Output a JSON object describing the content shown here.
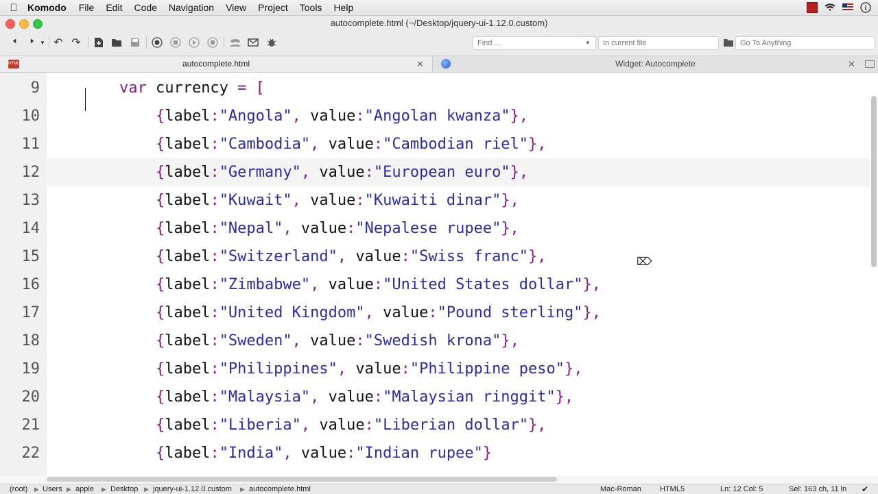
{
  "menubar": {
    "app": "Komodo",
    "items": [
      "File",
      "Edit",
      "Code",
      "Navigation",
      "View",
      "Project",
      "Tools",
      "Help"
    ]
  },
  "window": {
    "title": "autocomplete.html (~/Desktop/jquery-ui-1.12.0.custom)"
  },
  "toolbar": {
    "find_placeholder": "Find ...",
    "scope_placeholder": "In current file",
    "goto_placeholder": "Go To Anything"
  },
  "tabs": [
    {
      "label": "autocomplete.html",
      "icon": "html-file-icon",
      "active": true
    },
    {
      "label": "Widget: Autocomplete",
      "icon": "globe-icon",
      "active": false
    }
  ],
  "editor": {
    "current_line": 12,
    "lines": [
      {
        "number": "9",
        "tokens": [
          [
            "plain",
            "        "
          ],
          [
            "kw",
            "var"
          ],
          [
            "plain",
            " currency "
          ],
          [
            "op",
            "="
          ],
          [
            "plain",
            " "
          ],
          [
            "op",
            "["
          ]
        ]
      },
      {
        "number": "10",
        "tokens": [
          [
            "plain",
            "            "
          ],
          [
            "op",
            "{"
          ],
          [
            "plain",
            "label"
          ],
          [
            "op",
            ":"
          ],
          [
            "str",
            "\"Angola\""
          ],
          [
            "op",
            ","
          ],
          [
            "plain",
            " value"
          ],
          [
            "op",
            ":"
          ],
          [
            "str",
            "\"Angolan kwanza\""
          ],
          [
            "op",
            "},"
          ]
        ]
      },
      {
        "number": "11",
        "tokens": [
          [
            "plain",
            "            "
          ],
          [
            "op",
            "{"
          ],
          [
            "plain",
            "label"
          ],
          [
            "op",
            ":"
          ],
          [
            "str",
            "\"Cambodia\""
          ],
          [
            "op",
            ","
          ],
          [
            "plain",
            " value"
          ],
          [
            "op",
            ":"
          ],
          [
            "str",
            "\"Cambodian riel\""
          ],
          [
            "op",
            "},"
          ]
        ]
      },
      {
        "number": "12",
        "tokens": [
          [
            "plain",
            "            "
          ],
          [
            "op",
            "{"
          ],
          [
            "plain",
            "label"
          ],
          [
            "op",
            ":"
          ],
          [
            "str",
            "\"Germany\""
          ],
          [
            "op",
            ","
          ],
          [
            "plain",
            " value"
          ],
          [
            "op",
            ":"
          ],
          [
            "str",
            "\"European euro\""
          ],
          [
            "op",
            "},"
          ]
        ]
      },
      {
        "number": "13",
        "tokens": [
          [
            "plain",
            "            "
          ],
          [
            "op",
            "{"
          ],
          [
            "plain",
            "label"
          ],
          [
            "op",
            ":"
          ],
          [
            "str",
            "\"Kuwait\""
          ],
          [
            "op",
            ","
          ],
          [
            "plain",
            " value"
          ],
          [
            "op",
            ":"
          ],
          [
            "str",
            "\"Kuwaiti dinar\""
          ],
          [
            "op",
            "},"
          ]
        ]
      },
      {
        "number": "14",
        "tokens": [
          [
            "plain",
            "            "
          ],
          [
            "op",
            "{"
          ],
          [
            "plain",
            "label"
          ],
          [
            "op",
            ":"
          ],
          [
            "str",
            "\"Nepal\""
          ],
          [
            "op",
            ","
          ],
          [
            "plain",
            " value"
          ],
          [
            "op",
            ":"
          ],
          [
            "str",
            "\"Nepalese rupee\""
          ],
          [
            "op",
            "},"
          ]
        ]
      },
      {
        "number": "15",
        "tokens": [
          [
            "plain",
            "            "
          ],
          [
            "op",
            "{"
          ],
          [
            "plain",
            "label"
          ],
          [
            "op",
            ":"
          ],
          [
            "str",
            "\"Switzerland\""
          ],
          [
            "op",
            ","
          ],
          [
            "plain",
            " value"
          ],
          [
            "op",
            ":"
          ],
          [
            "str",
            "\"Swiss franc\""
          ],
          [
            "op",
            "},"
          ]
        ]
      },
      {
        "number": "16",
        "tokens": [
          [
            "plain",
            "            "
          ],
          [
            "op",
            "{"
          ],
          [
            "plain",
            "label"
          ],
          [
            "op",
            ":"
          ],
          [
            "str",
            "\"Zimbabwe\""
          ],
          [
            "op",
            ","
          ],
          [
            "plain",
            " value"
          ],
          [
            "op",
            ":"
          ],
          [
            "str",
            "\"United States dollar\""
          ],
          [
            "op",
            "},"
          ]
        ]
      },
      {
        "number": "17",
        "tokens": [
          [
            "plain",
            "            "
          ],
          [
            "op",
            "{"
          ],
          [
            "plain",
            "label"
          ],
          [
            "op",
            ":"
          ],
          [
            "str",
            "\"United Kingdom\""
          ],
          [
            "op",
            ","
          ],
          [
            "plain",
            " value"
          ],
          [
            "op",
            ":"
          ],
          [
            "str",
            "\"Pound sterling\""
          ],
          [
            "op",
            "},"
          ]
        ]
      },
      {
        "number": "18",
        "tokens": [
          [
            "plain",
            "            "
          ],
          [
            "op",
            "{"
          ],
          [
            "plain",
            "label"
          ],
          [
            "op",
            ":"
          ],
          [
            "str",
            "\"Sweden\""
          ],
          [
            "op",
            ","
          ],
          [
            "plain",
            " value"
          ],
          [
            "op",
            ":"
          ],
          [
            "str",
            "\"Swedish krona\""
          ],
          [
            "op",
            "},"
          ]
        ]
      },
      {
        "number": "19",
        "tokens": [
          [
            "plain",
            "            "
          ],
          [
            "op",
            "{"
          ],
          [
            "plain",
            "label"
          ],
          [
            "op",
            ":"
          ],
          [
            "str",
            "\"Philippines\""
          ],
          [
            "op",
            ","
          ],
          [
            "plain",
            " value"
          ],
          [
            "op",
            ":"
          ],
          [
            "str",
            "\"Philippine peso\""
          ],
          [
            "op",
            "},"
          ]
        ]
      },
      {
        "number": "20",
        "tokens": [
          [
            "plain",
            "            "
          ],
          [
            "op",
            "{"
          ],
          [
            "plain",
            "label"
          ],
          [
            "op",
            ":"
          ],
          [
            "str",
            "\"Malaysia\""
          ],
          [
            "op",
            ","
          ],
          [
            "plain",
            " value"
          ],
          [
            "op",
            ":"
          ],
          [
            "str",
            "\"Malaysian ringgit\""
          ],
          [
            "op",
            "},"
          ]
        ]
      },
      {
        "number": "21",
        "tokens": [
          [
            "plain",
            "            "
          ],
          [
            "op",
            "{"
          ],
          [
            "plain",
            "label"
          ],
          [
            "op",
            ":"
          ],
          [
            "str",
            "\"Liberia\""
          ],
          [
            "op",
            ","
          ],
          [
            "plain",
            " value"
          ],
          [
            "op",
            ":"
          ],
          [
            "str",
            "\"Liberian dollar\""
          ],
          [
            "op",
            "},"
          ]
        ]
      },
      {
        "number": "22",
        "tokens": [
          [
            "plain",
            "            "
          ],
          [
            "op",
            "{"
          ],
          [
            "plain",
            "label"
          ],
          [
            "op",
            ":"
          ],
          [
            "str",
            "\"India\""
          ],
          [
            "op",
            ","
          ],
          [
            "plain",
            " value"
          ],
          [
            "op",
            ":"
          ],
          [
            "str",
            "\"Indian rupee\""
          ],
          [
            "op",
            "}"
          ]
        ]
      }
    ]
  },
  "statusbar": {
    "breadcrumbs": [
      "(root)",
      "Users",
      "apple",
      "Desktop",
      "jquery-ui-1.12.0.custom",
      "autocomplete.html"
    ],
    "encoding": "Mac-Roman",
    "language": "HTML5",
    "position": "Ln: 12 Col: 5",
    "selection": "Sel: 163 ch, 11 ln"
  },
  "colors": {
    "keyword": "#8a1a8a",
    "string": "#2c2c9e",
    "current_line": "#f4f4f4"
  }
}
